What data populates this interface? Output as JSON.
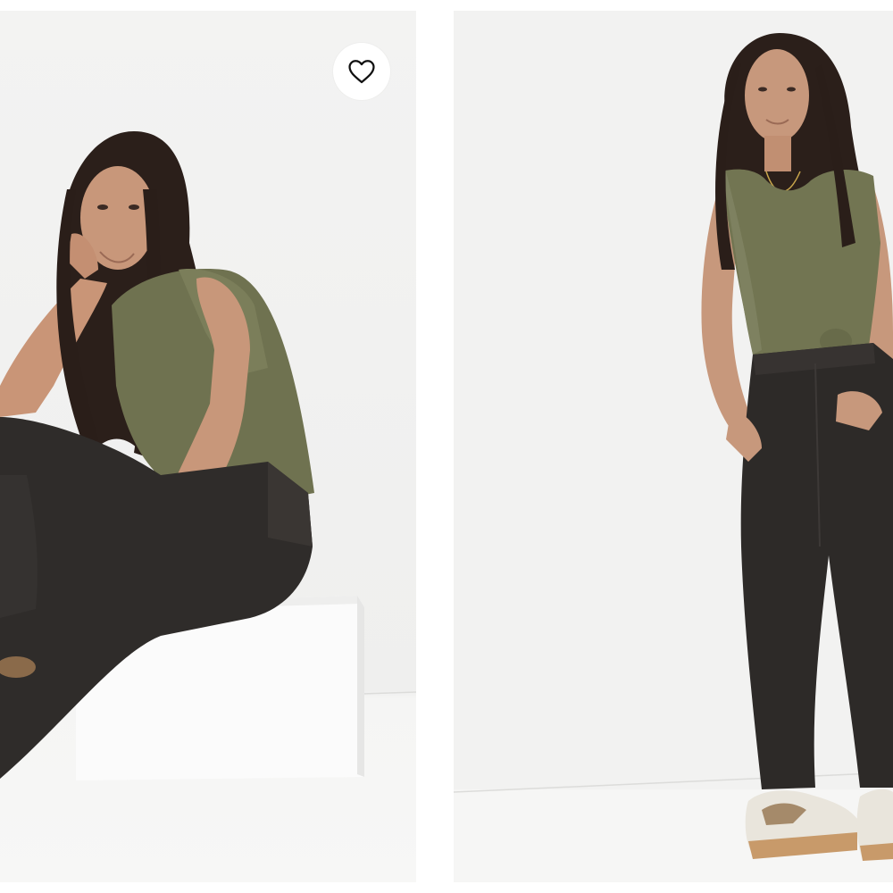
{
  "gallery": {
    "images": [
      {
        "name": "product-photo-seated",
        "top_color": "#6f7250",
        "jeans_color": "#2f2c2a"
      },
      {
        "name": "product-photo-standing",
        "top_color": "#727552",
        "jeans_color": "#2d2a28"
      }
    ],
    "wishlist": {
      "icon": "heart-outline-icon",
      "icon_color": "#111111",
      "state": "not-saved"
    }
  },
  "colors": {
    "page_background": "#ffffff",
    "photo_background": "#f1f1f0",
    "wishlist_button_background": "#ffffff"
  }
}
